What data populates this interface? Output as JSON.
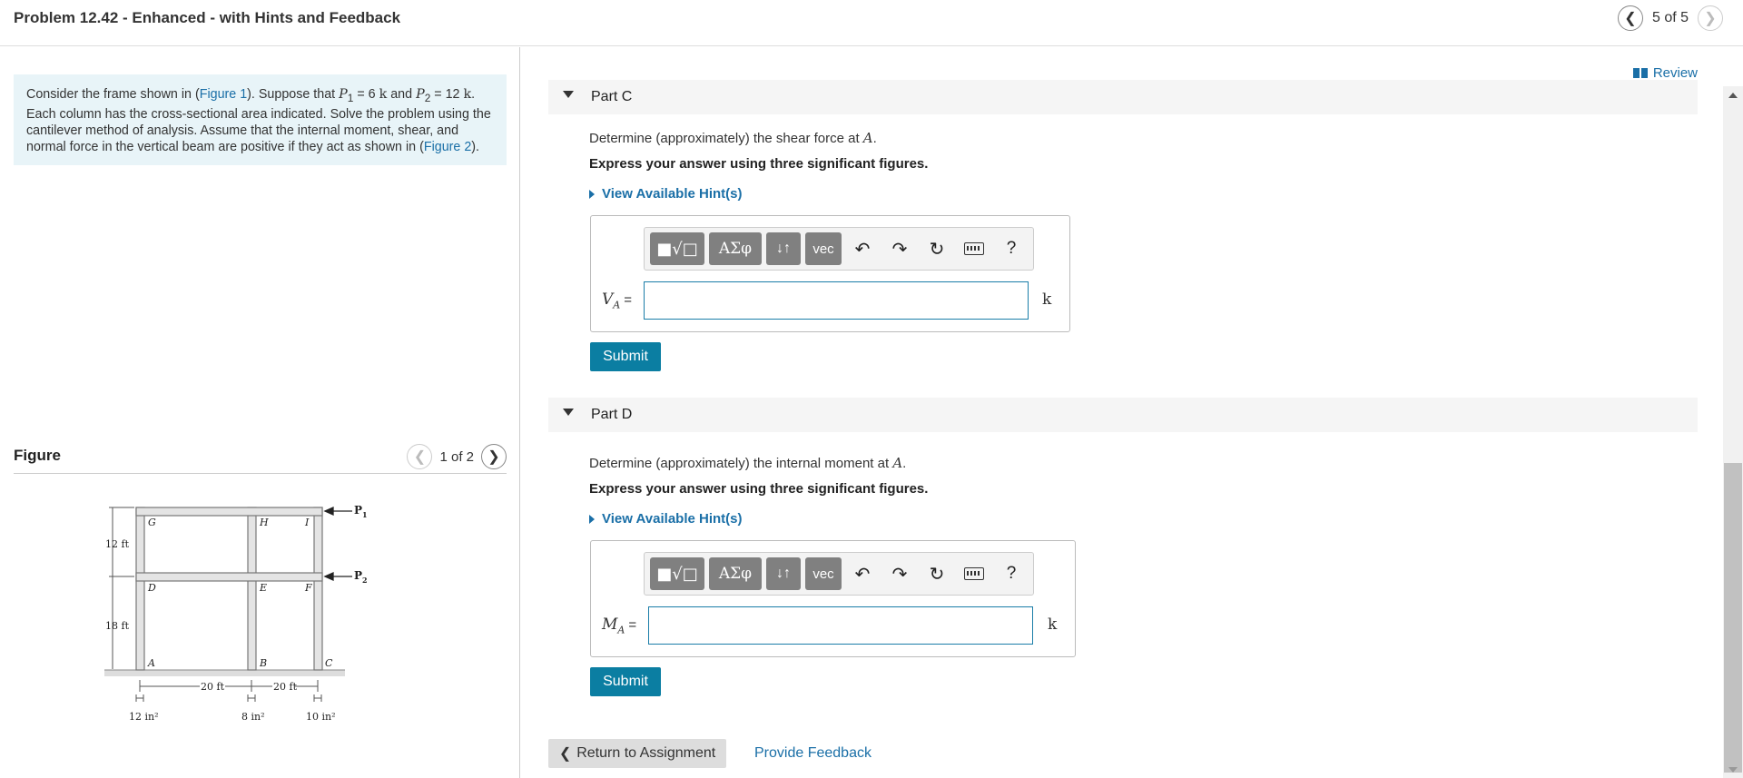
{
  "header": {
    "title": "Problem 12.42 - Enhanced - with Hints and Feedback",
    "pager": "5 of 5"
  },
  "statement": {
    "t1": "Consider the frame shown in (",
    "fig1": "Figure 1",
    "t2": "). Suppose that ",
    "p1": "P",
    "p1sub": "1",
    "t3": " = 6 ",
    "k1": "k",
    "t4": " and ",
    "p2": "P",
    "p2sub": "2",
    "t5": " = 12 ",
    "k2": "k",
    "t6": ".",
    "line2": "Each column has the cross-sectional area indicated. Solve the problem using the cantilever method of analysis. Assume that the internal moment, shear, and normal force in the vertical beam are positive if they act as shown in (",
    "fig2": "Figure 2",
    "t7": ")."
  },
  "figure": {
    "label": "Figure",
    "pager": "1 of 2",
    "labels": {
      "G": "G",
      "H": "H",
      "I": "I",
      "D": "D",
      "E": "E",
      "F": "F",
      "A": "A",
      "B": "B",
      "C": "C",
      "h1": "12 ft",
      "h2": "18 ft",
      "w1": "20 ft",
      "w2": "20 ft",
      "a1": "12 in²",
      "a2": "8 in²",
      "a3": "10 in²",
      "p1": "P",
      "p1sub": "1",
      "p2": "P",
      "p2sub": "2"
    }
  },
  "review": "Review",
  "partC": {
    "title": "Part C",
    "question_pre": "Determine (approximately) the shear force at ",
    "question_var": "A",
    "question_post": ".",
    "instruction": "Express your answer using three significant figures.",
    "hint": "View Available Hint(s)",
    "var": "V",
    "var_sub": "A",
    "eq": "=",
    "unit": "k",
    "submit": "Submit"
  },
  "partD": {
    "title": "Part D",
    "question_pre": "Determine (approximately) the internal moment at ",
    "question_var": "A",
    "question_post": ".",
    "instruction": "Express your answer using three significant figures.",
    "hint": "View Available Hint(s)",
    "var": "M",
    "var_sub": "A",
    "eq": "=",
    "unit": "k",
    "submit": "Submit"
  },
  "toolbar": {
    "templates": "■√□",
    "greek": "ΑΣφ",
    "arrows": "↓↑",
    "vec": "vec",
    "undo": "↶",
    "redo": "↷",
    "reset": "↻",
    "help": "?"
  },
  "footer": {
    "return": "Return to Assignment",
    "return_icon": "❮",
    "feedback": "Provide Feedback"
  },
  "icons": {
    "prev": "❮",
    "next": "❯"
  }
}
